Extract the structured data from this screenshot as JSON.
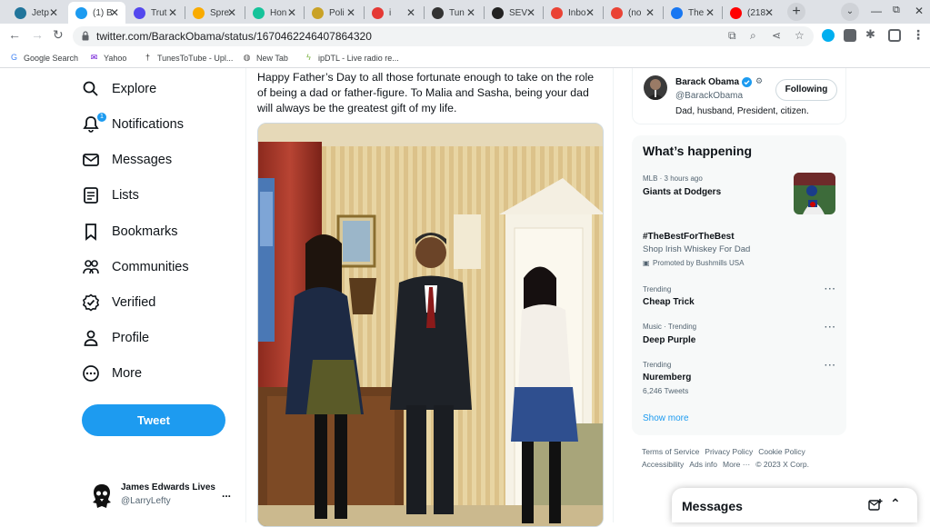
{
  "browser": {
    "tabs": [
      {
        "title": "Jetp",
        "icon": "wordpress-icon",
        "color": "#21759b"
      },
      {
        "title": "(1) B",
        "icon": "twitter-icon",
        "color": "#1d9bf0",
        "active": true
      },
      {
        "title": "Trut",
        "icon": "truth-social-icon",
        "color": "#5448ee"
      },
      {
        "title": "Spre",
        "icon": "star-icon",
        "color": "#f9ab00"
      },
      {
        "title": "Hon",
        "icon": "grammarly-icon",
        "color": "#15c39a"
      },
      {
        "title": "Poli",
        "icon": "politics-icon",
        "color": "#c9a227"
      },
      {
        "title": "i",
        "icon": "recording-icon",
        "color": "#e53935"
      },
      {
        "title": "Tun",
        "icon": "cross-icon",
        "color": "#333333"
      },
      {
        "title": "SEV",
        "icon": "skull-icon",
        "color": "#222222"
      },
      {
        "title": "Inbo",
        "icon": "gmail-icon",
        "color": "#ea4335"
      },
      {
        "title": "(no",
        "icon": "gmail-icon",
        "color": "#ea4335"
      },
      {
        "title": "The",
        "icon": "facebook-icon",
        "color": "#1877f2"
      },
      {
        "title": "(218",
        "icon": "youtube-icon",
        "color": "#ff0000"
      }
    ],
    "url": "twitter.com/BarackObama/status/1670462246407864320",
    "bookmarks": [
      {
        "label": "Google Search",
        "icon": "google-icon"
      },
      {
        "label": "Yahoo",
        "icon": "yahoo-icon"
      },
      {
        "label": "TunesToTube - Upl...",
        "icon": "cross-icon"
      },
      {
        "label": "New Tab",
        "icon": "globe-icon"
      },
      {
        "label": "ipDTL - Live radio re...",
        "icon": "ipdtl-icon"
      }
    ]
  },
  "sidebar": {
    "items": [
      {
        "label": "Explore",
        "icon": "search-icon"
      },
      {
        "label": "Notifications",
        "icon": "bell-icon"
      },
      {
        "label": "Messages",
        "icon": "envelope-icon"
      },
      {
        "label": "Lists",
        "icon": "list-icon"
      },
      {
        "label": "Bookmarks",
        "icon": "bookmark-icon"
      },
      {
        "label": "Communities",
        "icon": "people-icon"
      },
      {
        "label": "Verified",
        "icon": "verified-icon"
      },
      {
        "label": "Profile",
        "icon": "person-icon"
      },
      {
        "label": "More",
        "icon": "more-circle-icon"
      }
    ],
    "notification_count": "1",
    "tweet_button": "Tweet",
    "account": {
      "name": "James Edwards Lives",
      "handle": "@LarryLefty",
      "more": "..."
    }
  },
  "tweet": {
    "text": "Happy Father’s Day to all those fortunate enough to take on the role of being a dad or father-figure. To Malia and Sasha, being your dad will always be the greatest gift of my life."
  },
  "right": {
    "profile": {
      "name": "Barack Obama",
      "handle": "@BarackObama",
      "follow_label": "Following",
      "bio": "Dad, husband, President, citizen."
    },
    "trends_title": "What’s happening",
    "trends": [
      {
        "meta": "MLB · 3 hours ago",
        "title": "Giants at Dodgers"
      },
      {
        "title": "#TheBestForTheBest",
        "sub": "Shop Irish Whiskey For Dad",
        "promo": "Promoted by Bushmills USA"
      },
      {
        "meta": "Trending",
        "title": "Cheap Trick"
      },
      {
        "meta": "Music · Trending",
        "title": "Deep Purple"
      },
      {
        "meta": "Trending",
        "title": "Nuremberg",
        "sub": "6,246 Tweets"
      }
    ],
    "show_more": "Show more",
    "footer": [
      "Terms of Service",
      "Privacy Policy",
      "Cookie Policy",
      "Accessibility",
      "Ads info",
      "More ···",
      "© 2023 X Corp."
    ]
  },
  "messages_drawer": {
    "title": "Messages"
  }
}
